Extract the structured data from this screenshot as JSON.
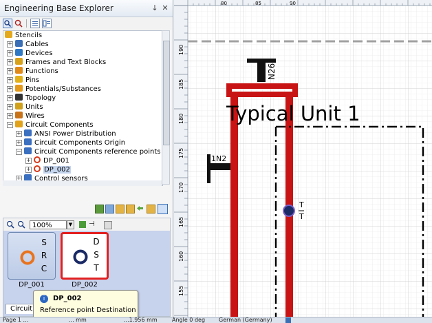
{
  "panel": {
    "title": "Engineering Base Explorer",
    "pin_glyph": "↓",
    "close_glyph": "✕"
  },
  "tree": {
    "root": "Stencils",
    "items": [
      {
        "label": "Cables",
        "icon": "cables-icon",
        "color": "#3a6fb5"
      },
      {
        "label": "Devices",
        "icon": "devices-icon",
        "color": "#2f78c4"
      },
      {
        "label": "Frames and Text Blocks",
        "icon": "frames-icon",
        "color": "#d9a21b"
      },
      {
        "label": "Functions",
        "icon": "functions-icon",
        "color": "#e08a1a"
      },
      {
        "label": "Pins",
        "icon": "pins-icon",
        "color": "#e2b11a"
      },
      {
        "label": "Potentials/Substances",
        "icon": "potentials-icon",
        "color": "#e39a1c"
      },
      {
        "label": "Topology",
        "icon": "topology-icon",
        "color": "#333333"
      },
      {
        "label": "Units",
        "icon": "units-icon",
        "color": "#d1a11c"
      },
      {
        "label": "Wires",
        "icon": "wires-icon",
        "color": "#c8731a"
      },
      {
        "label": "Circuit Components",
        "icon": "circuit-components-icon",
        "color": "#e1a21b"
      },
      {
        "label": "ANSI Power Distribution",
        "icon": "ansi-icon",
        "color": "#3b6fbf"
      },
      {
        "label": "Circuit Components Origin",
        "icon": "origin-icon",
        "color": "#3b6fbf"
      },
      {
        "label": "Circuit Components reference points",
        "icon": "reference-points-icon",
        "color": "#3b6fbf"
      },
      {
        "label": "DP_001",
        "icon": "target-icon",
        "color": "#d83a1a"
      },
      {
        "label": "DP_002",
        "icon": "target-icon",
        "color": "#d83a1a"
      },
      {
        "label": "Control sensors",
        "icon": "sensors-icon",
        "color": "#3b6fbf"
      }
    ]
  },
  "zoom": {
    "value": "100%"
  },
  "stencils": [
    {
      "name": "DP_001",
      "letters": [
        "S",
        "R",
        "C"
      ],
      "ring_color": "#e8731e"
    },
    {
      "name": "DP_002",
      "letters": [
        "D",
        "S",
        "T"
      ],
      "ring_color": "#1a2a66"
    }
  ],
  "tab": {
    "label": "Circuit"
  },
  "tooltip": {
    "title": "DP_002",
    "text": "Reference point Destination"
  },
  "status": {
    "page": "Page 1 ...",
    "dims": "...  mm",
    "width": "...1.956 mm",
    "angle": "Angle 0 deg",
    "language": "German (Germany)"
  },
  "canvas": {
    "ruler_top_labels": [
      "80",
      "85",
      "90"
    ],
    "ruler_left_labels": [
      "190",
      "185",
      "180",
      "175",
      "170",
      "165",
      "160",
      "155"
    ],
    "drawing": {
      "title": "Typical Unit 1",
      "tag_top": "N26",
      "tag_left": "1N2",
      "ref_top": "T",
      "ref_bottom": "T"
    },
    "colors": {
      "wire": "#c81414",
      "grid": "#d9d9d9",
      "frame": "#000000",
      "ref_fill": "#1a2a66"
    }
  }
}
